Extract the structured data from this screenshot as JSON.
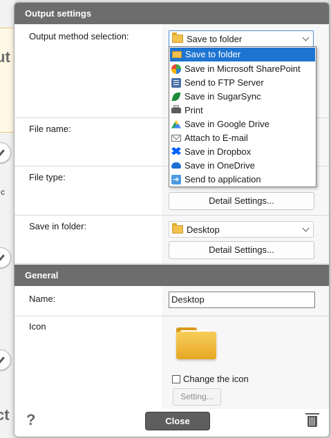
{
  "background": {
    "fragment_1": "ut",
    "fragment_2": "c",
    "fragment_3": "ct"
  },
  "output_settings": {
    "header": "Output settings",
    "method_label": "Output method selection:",
    "method_value": "Save to folder",
    "method_options": [
      {
        "label": "Save to folder",
        "icon": "folder-icon"
      },
      {
        "label": "Save in Microsoft SharePoint",
        "icon": "sharepoint-icon"
      },
      {
        "label": "Send to FTP Server",
        "icon": "ftp-server-icon"
      },
      {
        "label": "Save in SugarSync",
        "icon": "sugarsync-icon"
      },
      {
        "label": "Print",
        "icon": "printer-icon"
      },
      {
        "label": "Save in Google Drive",
        "icon": "google-drive-icon"
      },
      {
        "label": "Attach to E-mail",
        "icon": "email-icon"
      },
      {
        "label": "Save in Dropbox",
        "icon": "dropbox-icon"
      },
      {
        "label": "Save in OneDrive",
        "icon": "onedrive-icon"
      },
      {
        "label": "Send to application",
        "icon": "send-to-application-icon"
      }
    ],
    "file_name_label": "File name:",
    "file_type_label": "File type:",
    "file_type_detail_button": "Detail Settings...",
    "save_in_folder_label": "Save in folder:",
    "save_in_folder_value": "Desktop",
    "save_in_folder_detail_button": "Detail Settings..."
  },
  "general": {
    "header": "General",
    "name_label": "Name:",
    "name_value": "Desktop",
    "icon_label": "Icon",
    "change_icon_label": "Change the icon",
    "change_icon_checked": false,
    "setting_button": "Setting..."
  },
  "footer": {
    "help_icon": "?",
    "close_button": "Close"
  }
}
